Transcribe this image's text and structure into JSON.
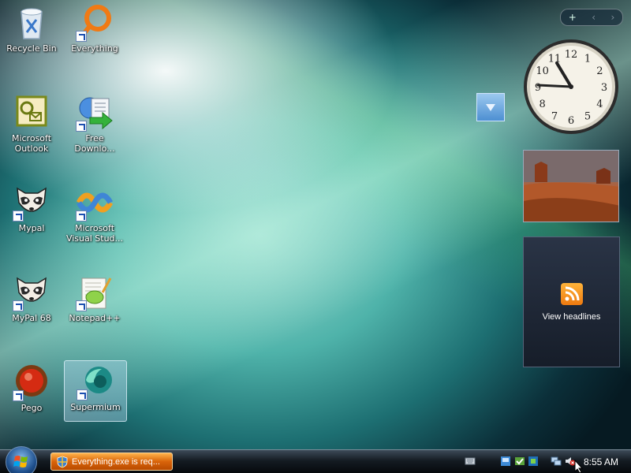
{
  "desktop": {
    "icons": [
      {
        "label": "Recycle Bin"
      },
      {
        "label": "Everything"
      },
      {
        "label": "Microsoft\nOutlook"
      },
      {
        "label": "Free\nDownlo..."
      },
      {
        "label": "Mypal"
      },
      {
        "label": "Microsoft\nVisual Stud..."
      },
      {
        "label": "MyPal 68"
      },
      {
        "label": "Notepad++"
      },
      {
        "label": "Pego"
      },
      {
        "label": "Supermium"
      }
    ]
  },
  "sidebar": {
    "controls": {
      "add": "+",
      "prev": "‹",
      "next": "›"
    },
    "clock": {
      "numbers": [
        "12",
        "1",
        "2",
        "3",
        "4",
        "5",
        "6",
        "7",
        "8",
        "9",
        "10",
        "11"
      ]
    },
    "feed": {
      "label": "View headlines"
    }
  },
  "taskbar": {
    "task_button": {
      "label": "Everything.exe is req..."
    },
    "clock": "8:55 AM"
  }
}
